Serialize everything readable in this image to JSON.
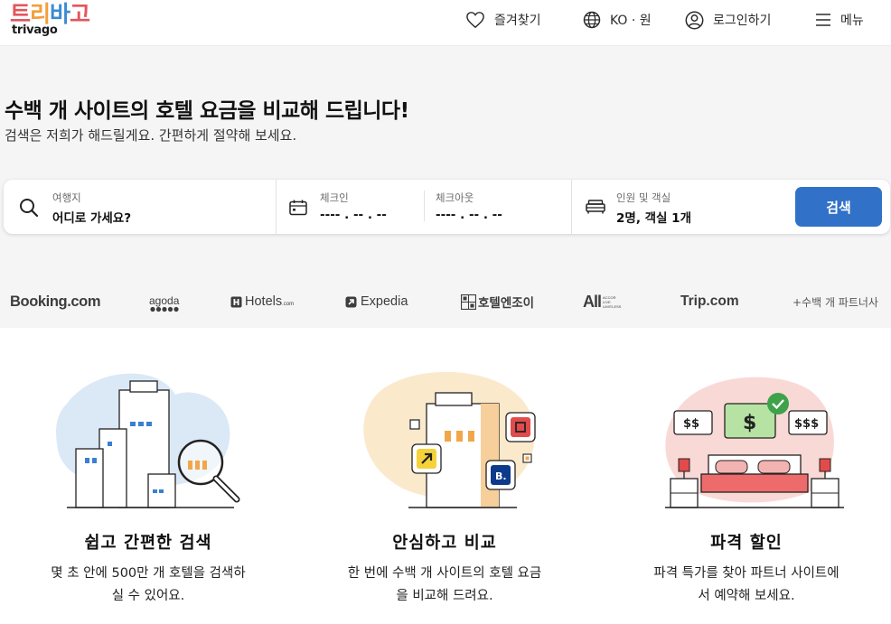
{
  "header": {
    "logo_kr": [
      "트",
      "리",
      "바",
      "고"
    ],
    "logo_en": "trivago",
    "favorites": "즐겨찾기",
    "language": "KO · 원",
    "login": "로그인하기",
    "menu": "메뉴"
  },
  "hero": {
    "title": "수백 개 사이트의 호텔 요금을 비교해 드립니다!",
    "subtitle": "검색은 저희가 해드릴게요. 간편하게 절약해 보세요."
  },
  "search": {
    "destination_label": "여행지",
    "destination_placeholder": "어디로 가세요?",
    "checkin_label": "체크인",
    "checkin_value": "---- . -- . --",
    "checkout_label": "체크아웃",
    "checkout_value": "---- . -- . --",
    "guests_label": "인원 및 객실",
    "guests_value": "2명, 객실 1개",
    "button": "검색"
  },
  "partners": {
    "booking": "Booking.com",
    "agoda": "agoda",
    "hotels": "Hotels",
    "hotels_suffix": ".com",
    "expedia": "Expedia",
    "hotel_n_joy": "호텔엔조이",
    "accor": "All",
    "accor_small": [
      "ACCOR",
      "LIVE",
      "LIMITLESS"
    ],
    "trip": "Trip.com",
    "more": "+수백 개 파트너사"
  },
  "features": [
    {
      "title": "쉽고 간편한 검색",
      "desc_line1": "몇 초 안에 500만 개 호텔을 검색하",
      "desc_line2": "실 수 있어요."
    },
    {
      "title": "안심하고 비교",
      "desc_line1": "한 번에 수백 개 사이트의 호텔 요금",
      "desc_line2": "을 비교해 드려요."
    },
    {
      "title": "파격 할인",
      "desc_line1": "파격 특가를 찾아 파트너 사이트에",
      "desc_line2": "서 예약해 보세요."
    }
  ],
  "illustrations": {
    "price_tags": [
      "$$",
      "$",
      "$$$"
    ],
    "partner_badge": "B."
  },
  "colors": {
    "brand_blue": "#3172c8",
    "logo_red": "#e3565c",
    "logo_orange": "#f29e3b",
    "logo_blue": "#3a8bd4"
  }
}
